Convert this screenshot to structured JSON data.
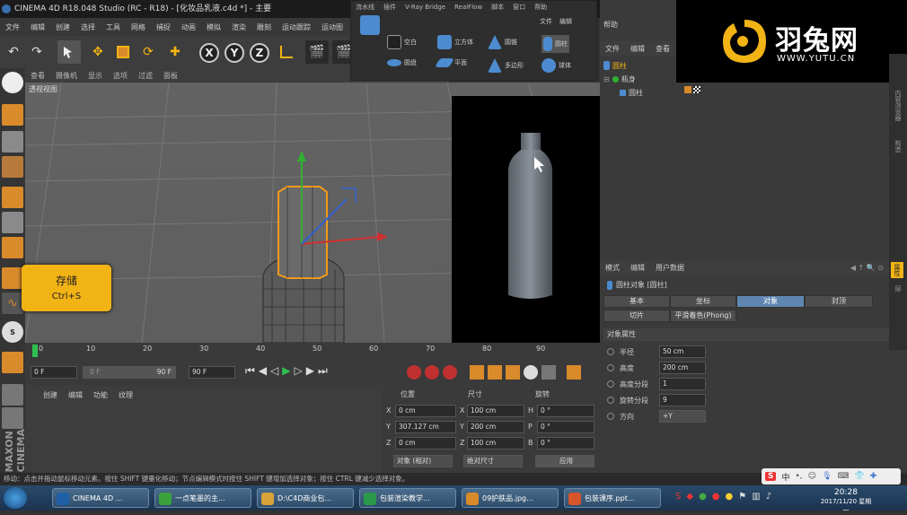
{
  "window": {
    "title": "CINEMA 4D R18.048 Studio (RC - R18) - [化妆品乳液.c4d *] - 主要"
  },
  "menubar": [
    "文件",
    "编辑",
    "创建",
    "选择",
    "工具",
    "网格",
    "捕捉",
    "动画",
    "模拟",
    "渲染",
    "雕刻",
    "运动跟踪",
    "运动图"
  ],
  "viewport": {
    "menu": [
      "查看",
      "摄像机",
      "显示",
      "选项",
      "过滤",
      "面板"
    ],
    "label": "透视视图"
  },
  "popup": {
    "menu": [
      "流水线",
      "插件",
      "V-Ray Bridge",
      "RealFlow",
      "脚本",
      "窗口",
      "帮助"
    ],
    "items": [
      {
        "label": "空白",
        "icon": "null-object-icon"
      },
      {
        "label": "立方体",
        "icon": "cube-icon"
      },
      {
        "label": "圆锥",
        "icon": "cone-icon"
      },
      {
        "label": "圆柱",
        "icon": "cylinder-icon"
      },
      {
        "label": "圆盘",
        "icon": "disc-icon"
      },
      {
        "label": "平面",
        "icon": "plane-icon"
      },
      {
        "label": "多边形",
        "icon": "polygon-icon"
      },
      {
        "label": "球体",
        "icon": "sphere-icon"
      }
    ]
  },
  "save_tooltip": {
    "title": "存储",
    "shortcut": "Ctrl+S"
  },
  "timeline": {
    "ticks": [
      "0",
      "10",
      "20",
      "30",
      "40",
      "50",
      "60",
      "70",
      "80",
      "90"
    ]
  },
  "transport": {
    "start": "0 F",
    "range_start": "0 F",
    "range_end": "90 F",
    "end": "90 F"
  },
  "material_panel": {
    "menu": [
      "创建",
      "编辑",
      "功能",
      "纹理"
    ]
  },
  "coord_panel": {
    "headers": [
      "位置",
      "尺寸",
      "旋转"
    ],
    "rows": [
      {
        "a": "X",
        "pos": "0 cm",
        "b": "X",
        "size": "100 cm",
        "c": "H",
        "rot": "0 °"
      },
      {
        "a": "Y",
        "pos": "307.127 cm",
        "b": "Y",
        "size": "200 cm",
        "c": "P",
        "rot": "0 °"
      },
      {
        "a": "Z",
        "pos": "0 cm",
        "b": "Z",
        "size": "100 cm",
        "c": "B",
        "rot": "0 °"
      }
    ],
    "mode": "对象 (相对)",
    "size_mode": "绝对尺寸",
    "apply": "应用"
  },
  "object_manager": {
    "menu": [
      "文件",
      "编辑",
      "查看"
    ],
    "popup_extra": [
      "文件",
      "编辑"
    ],
    "help": "帮助",
    "items": [
      {
        "label": "圆柱",
        "indent": 0
      },
      {
        "label": "瓶身",
        "indent": 0
      },
      {
        "label": "圆柱",
        "indent": 1
      }
    ]
  },
  "attributes": {
    "menu": [
      "模式",
      "编辑",
      "用户数据"
    ],
    "object_title": "圆柱对象 [圆柱]",
    "tabs_row1": [
      "基本",
      "坐标",
      "对象",
      "封顶"
    ],
    "tabs_row2": [
      "切片",
      "平滑着色(Phong)"
    ],
    "active_tab": "对象",
    "section": "对象属性",
    "props": [
      {
        "label": "半径",
        "value": "50 cm"
      },
      {
        "label": "高度",
        "value": "200 cm"
      },
      {
        "label": "高度分段",
        "value": "1"
      },
      {
        "label": "旋转分段",
        "value": "9"
      },
      {
        "label": "方向",
        "value": "+Y"
      }
    ]
  },
  "side_tabs": [
    "内容浏览器",
    "构造",
    "属性",
    "层"
  ],
  "status": "移动：点击并拖动鼠标移动元素。按住 SHIFT 键量化移动；节点编辑模式时按住 SHIFT 键增加选择对象；按住 CTRL 键减少选择对象。",
  "taskbar": {
    "tasks": [
      {
        "label": "CINEMA 4D ...",
        "color": "#1f5fa8"
      },
      {
        "label": "一点笔墨的主...",
        "color": "#3aa23a"
      },
      {
        "label": "D:\\C4D商业包...",
        "color": "#d9a23a"
      },
      {
        "label": "包装渲染教学...",
        "color": "#2a9a4a"
      },
      {
        "label": "09护肤品.jpg...",
        "color": "#d98a2a"
      },
      {
        "label": "包装课序.ppt...",
        "color": "#d9552a"
      }
    ],
    "tray_lang": "中",
    "time": "20:28",
    "date": "2017/11/20 星期一"
  },
  "brand": {
    "name": "羽兔网",
    "url": "WWW.YUTU.CN",
    "accent": "#f2b315"
  },
  "colors": {
    "accent": "#f2b315",
    "selection": "#5f86b0",
    "x_axis": "#d03030",
    "y_axis": "#30b030",
    "z_axis": "#3060d0"
  }
}
